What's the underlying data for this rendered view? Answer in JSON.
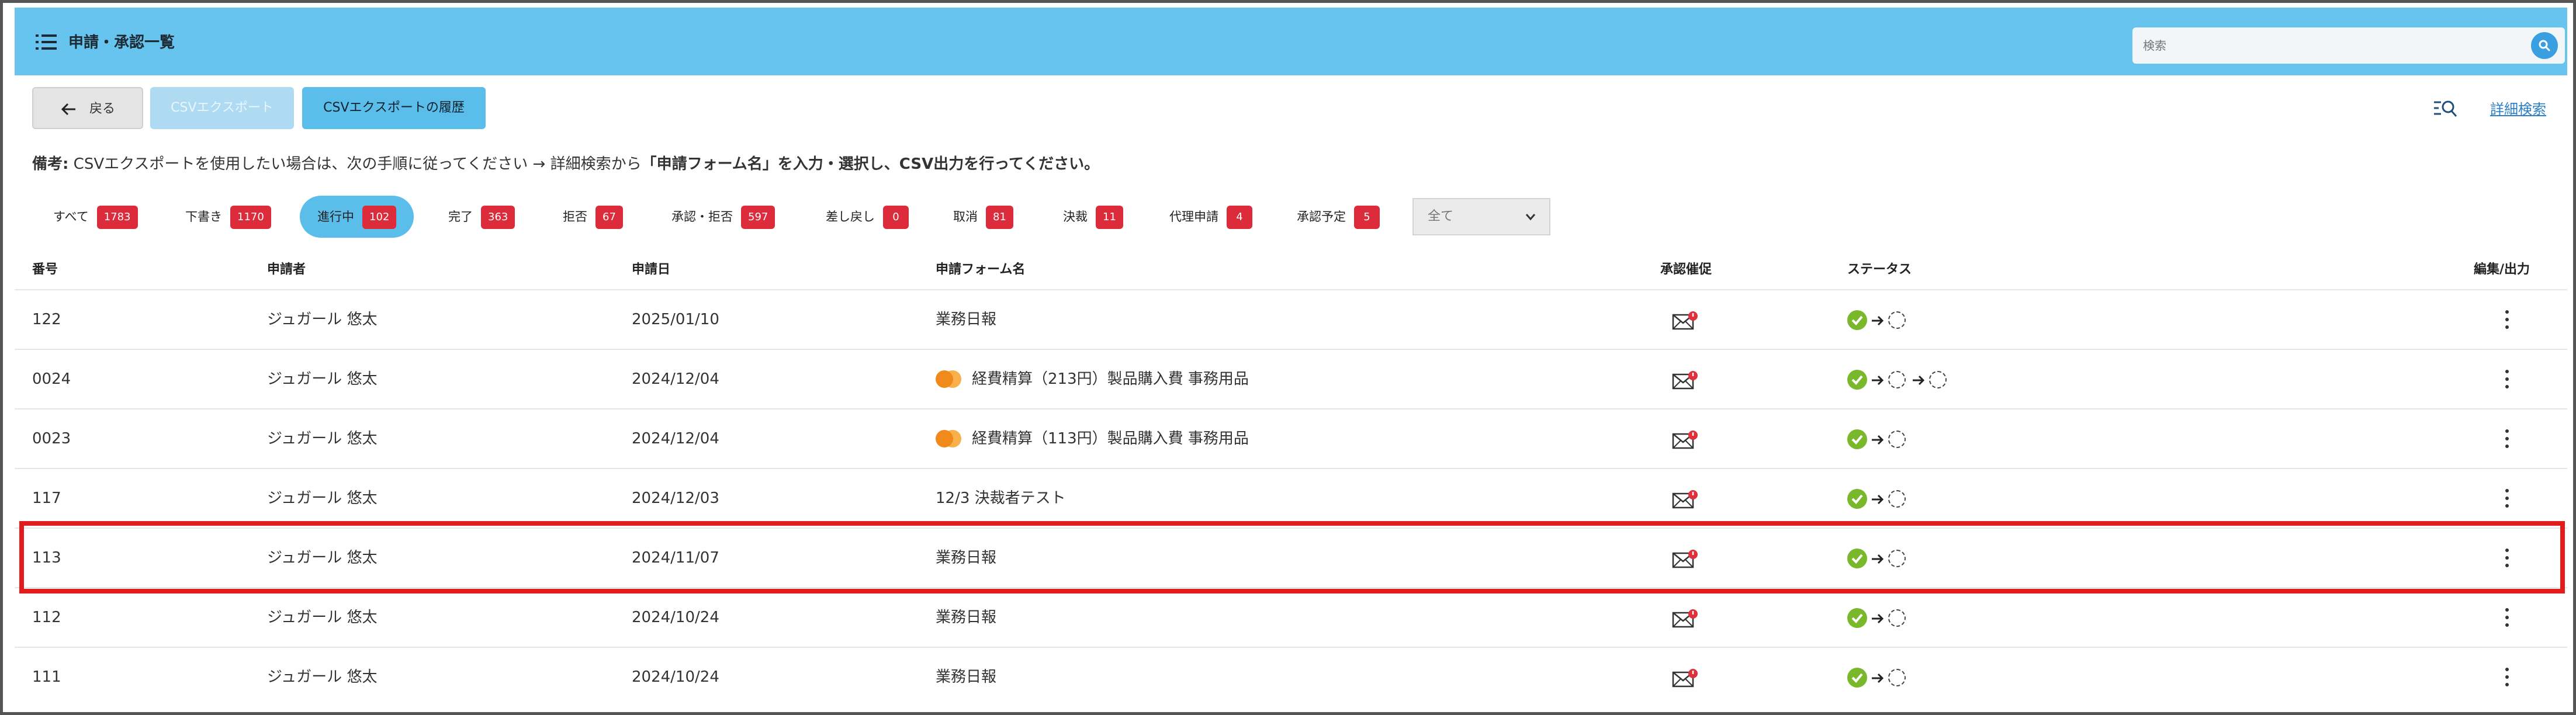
{
  "header": {
    "title": "申請・承認一覧",
    "search_placeholder": "検索"
  },
  "toolbar": {
    "back_label": "戻る",
    "csv_export_label": "CSVエクスポート",
    "csv_history_label": "CSVエクスポートの履歴",
    "advanced_search_label": "詳細検索"
  },
  "note": {
    "prefix": "備考:",
    "text": "CSVエクスポートを使用したい場合は、次の手順に従ってください → 詳細検索から",
    "bold": "「申請フォーム名」を入力・選択し、CSV出力を行ってください。"
  },
  "filters": [
    {
      "label": "すべて",
      "count": "1783"
    },
    {
      "label": "下書き",
      "count": "1170"
    },
    {
      "label": "進行中",
      "count": "102"
    },
    {
      "label": "完了",
      "count": "363"
    },
    {
      "label": "拒否",
      "count": "67"
    },
    {
      "label": "承認・拒否",
      "count": "597"
    },
    {
      "label": "差し戻し",
      "count": "0"
    },
    {
      "label": "取消",
      "count": "81"
    },
    {
      "label": "決裁",
      "count": "11"
    },
    {
      "label": "代理申請",
      "count": "4"
    },
    {
      "label": "承認予定",
      "count": "5"
    }
  ],
  "active_filter": "進行中",
  "select": {
    "value": "全て"
  },
  "table": {
    "columns": [
      "番号",
      "申請者",
      "申請日",
      "申請フォーム名",
      "承認催促",
      "ステータス",
      "編集/出力"
    ],
    "rows": [
      {
        "number": "122",
        "applicant": "ジュガール 悠太",
        "date": "2025/01/10",
        "form": "業務日報",
        "badge": false,
        "pending_steps": 1
      },
      {
        "number": "0024",
        "applicant": "ジュガール 悠太",
        "date": "2024/12/04",
        "form": "経費精算（213円）製品購入費 事務用品",
        "badge": true,
        "pending_steps": 2
      },
      {
        "number": "0023",
        "applicant": "ジュガール 悠太",
        "date": "2024/12/04",
        "form": "経費精算（113円）製品購入費 事務用品",
        "badge": true,
        "pending_steps": 1
      },
      {
        "number": "117",
        "applicant": "ジュガール 悠太",
        "date": "2024/12/03",
        "form": "12/3 決裁者テスト",
        "badge": false,
        "pending_steps": 1
      },
      {
        "number": "113",
        "applicant": "ジュガール 悠太",
        "date": "2024/11/07",
        "form": "業務日報",
        "badge": false,
        "pending_steps": 1
      },
      {
        "number": "112",
        "applicant": "ジュガール 悠太",
        "date": "2024/10/24",
        "form": "業務日報",
        "badge": false,
        "pending_steps": 1
      },
      {
        "number": "111",
        "applicant": "ジュガール 悠太",
        "date": "2024/10/24",
        "form": "業務日報",
        "badge": false,
        "pending_steps": 1
      }
    ]
  },
  "colors": {
    "header_bg": "#66c4ef",
    "accent": "#5bbde9",
    "count_badge": "#dc2b3a",
    "status_done": "#7ab82b",
    "highlight": "#e21c1c"
  }
}
